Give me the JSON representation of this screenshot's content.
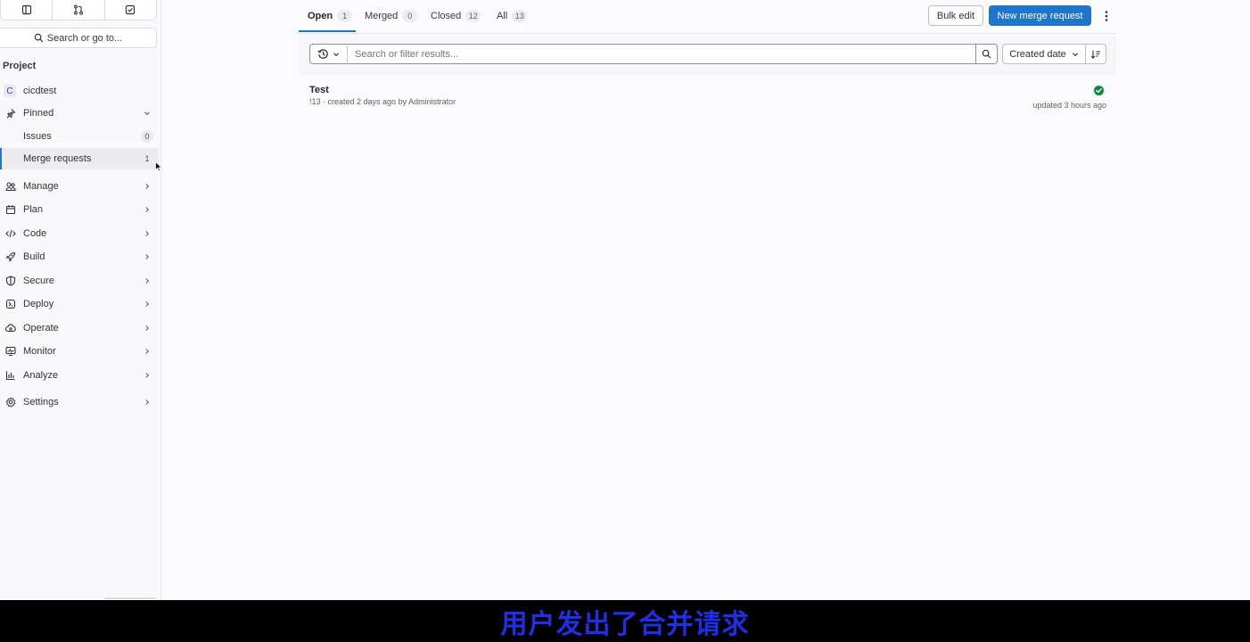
{
  "sidebar": {
    "top_buttons": [
      {
        "icon": "sidebar-toggle-icon"
      },
      {
        "icon": "merge-request-icon"
      },
      {
        "icon": "todo-icon"
      }
    ],
    "search_label": "Search or go to...",
    "section_label": "Project",
    "project": {
      "avatar_letter": "C",
      "name": "cicdtest"
    },
    "pinned": {
      "label": "Pinned",
      "items": [
        {
          "label": "Issues",
          "count": "0"
        },
        {
          "label": "Merge requests",
          "count": "1",
          "active": true
        }
      ]
    },
    "menu": [
      {
        "label": "Manage",
        "icon": "users-icon"
      },
      {
        "label": "Plan",
        "icon": "calendar-icon"
      },
      {
        "label": "Code",
        "icon": "code-icon"
      },
      {
        "label": "Build",
        "icon": "rocket-icon"
      },
      {
        "label": "Secure",
        "icon": "shield-icon"
      },
      {
        "label": "Deploy",
        "icon": "deploy-icon"
      },
      {
        "label": "Operate",
        "icon": "cloud-icon"
      },
      {
        "label": "Monitor",
        "icon": "monitor-icon"
      },
      {
        "label": "Analyze",
        "icon": "chart-icon"
      },
      {
        "label": "Settings",
        "icon": "gear-icon"
      }
    ]
  },
  "tabs": [
    {
      "label": "Open",
      "count": "1",
      "active": true
    },
    {
      "label": "Merged",
      "count": "0"
    },
    {
      "label": "Closed",
      "count": "12"
    },
    {
      "label": "All",
      "count": "13"
    }
  ],
  "actions": {
    "bulk_edit": "Bulk edit",
    "new_mr": "New merge request"
  },
  "filter": {
    "placeholder": "Search or filter results...",
    "sort_label": "Created date"
  },
  "merge_requests": [
    {
      "title": "Test",
      "meta": "!13 · created 2 days ago by Administrator",
      "updated": "updated 3 hours ago",
      "status": "pipeline-passed"
    }
  ],
  "colors": {
    "accent": "#1f75cb",
    "success": "#108548",
    "caption": "#1f2fe6"
  },
  "caption": "用户发出了合并请求"
}
